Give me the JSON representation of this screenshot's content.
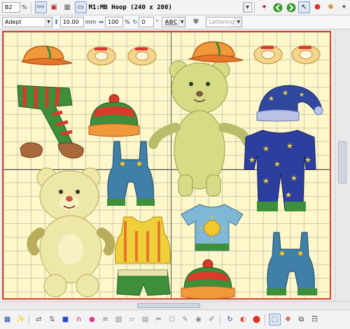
{
  "toolbar_top": {
    "design_name": "B2",
    "zoom_label": "%",
    "hoop_label": "M1:MB Hoop (240 x 200)"
  },
  "toolbar_props": {
    "font": "Adept",
    "size_value": "10.00",
    "size_unit": "mm",
    "width_value": "100",
    "width_unit": "%",
    "angle_value": "0",
    "angle_unit": "°",
    "style_label": "ABC",
    "lettering_art": "Lettering Art"
  },
  "canvas": {
    "hoop_color": "#fdf7c9",
    "border_color": "#d6452d",
    "designs": [
      {
        "name": "orange-cap",
        "kind": "cap"
      },
      {
        "name": "shoes",
        "kind": "shoes"
      },
      {
        "name": "striped-scarf",
        "kind": "scarf"
      },
      {
        "name": "striped-beanie",
        "kind": "beanie"
      },
      {
        "name": "mittens",
        "kind": "mittens"
      },
      {
        "name": "teddy-bear",
        "kind": "bear"
      },
      {
        "name": "overalls",
        "kind": "overalls"
      },
      {
        "name": "star-nightcap",
        "kind": "nightcap"
      },
      {
        "name": "star-pajamas",
        "kind": "pajamas"
      },
      {
        "name": "sun-tshirt",
        "kind": "tshirt"
      },
      {
        "name": "tank-top",
        "kind": "tank"
      },
      {
        "name": "green-shorts",
        "kind": "shorts"
      }
    ]
  }
}
